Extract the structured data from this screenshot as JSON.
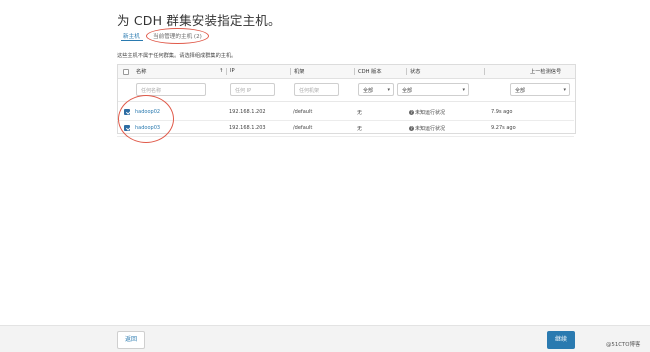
{
  "page": {
    "title": "为 CDH 群集安装指定主机。",
    "tabs": [
      {
        "label": "新主机",
        "active": true
      },
      {
        "label": "当前管理的主机 (2)",
        "active": false
      }
    ],
    "notice": "这些主机不属于任何群集。请选择组成群集的主机。"
  },
  "table": {
    "columns": [
      {
        "label": "名称"
      },
      {
        "label": "↑"
      },
      {
        "label": "IP"
      },
      {
        "label": "机架"
      },
      {
        "label": "CDH 版本"
      },
      {
        "label": "状态"
      },
      {
        "label": "上一检测信号"
      }
    ],
    "filters": {
      "name_placeholder": "任何名称",
      "ip_placeholder": "任何 IP",
      "rack_placeholder": "任何机架",
      "cdh_version": "全部",
      "status": "全部",
      "last_heartbeat": "全部",
      "caret": "▾"
    },
    "rows": [
      {
        "name": "hadoop02",
        "ip": "192.168.1.202",
        "rack": "/default",
        "cdh": "无",
        "status": "未知运行状况",
        "heartbeat": "7.9s ago",
        "checked": true
      },
      {
        "name": "hadoop03",
        "ip": "192.168.1.203",
        "rack": "/default",
        "cdh": "无",
        "status": "未知运行状况",
        "heartbeat": "9.27s ago",
        "checked": true
      }
    ],
    "help_glyph": "?"
  },
  "footer": {
    "back_label": "返回",
    "continue_label": "继续"
  },
  "watermark": "@51CTO博客",
  "colors": {
    "accent": "#2a7ab0",
    "annotation": "#e05a4a",
    "checkbox_checked": "#2d6da3"
  }
}
